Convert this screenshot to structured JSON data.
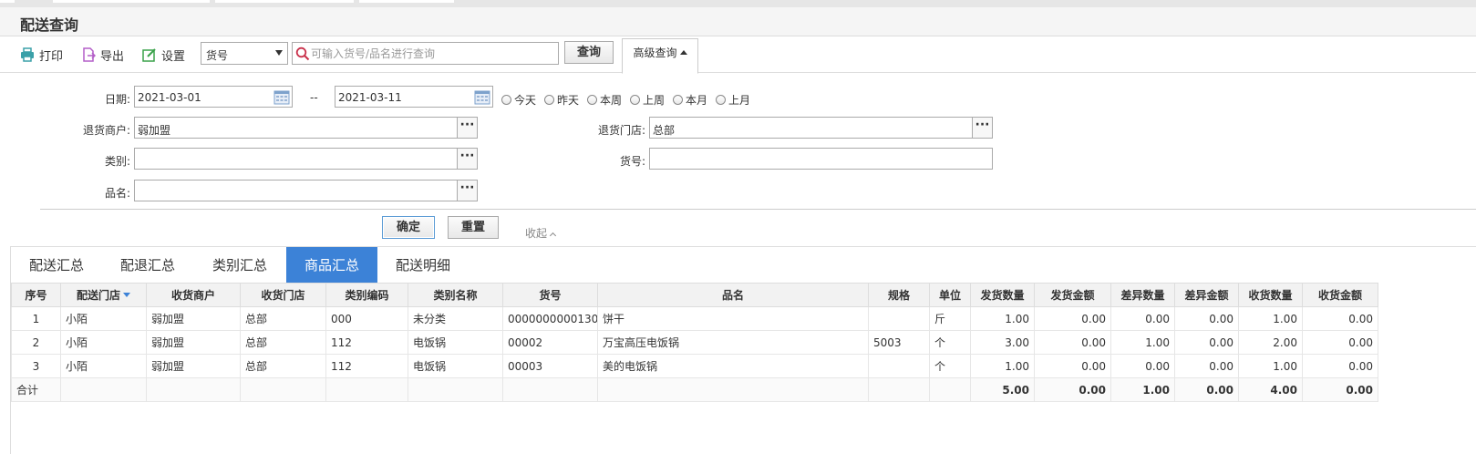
{
  "title": "配送查询",
  "toolbar": {
    "print_label": "打印",
    "export_label": "导出",
    "settings_label": "设置",
    "field_select": "货号",
    "search_placeholder": "可输入货号/品名进行查询",
    "query_label": "查询",
    "advanced_label": "高级查询"
  },
  "filters": {
    "date_label": "日期:",
    "date_from": "2021-03-01",
    "date_sep": "--",
    "date_to": "2021-03-11",
    "quick_dates": [
      "今天",
      "昨天",
      "本周",
      "上周",
      "本月",
      "上月"
    ],
    "merchant_label": "退货商户:",
    "merchant_value": "弱加盟",
    "store_label": "退货门店:",
    "store_value": "总部",
    "category_label": "类别:",
    "category_value": "",
    "sku_label": "货号:",
    "sku_value": "",
    "name_label": "品名:",
    "name_value": "",
    "confirm_label": "确定",
    "reset_label": "重置",
    "collapse_label": "收起"
  },
  "tabs": [
    "配送汇总",
    "配退汇总",
    "类别汇总",
    "商品汇总",
    "配送明细"
  ],
  "active_tab": "商品汇总",
  "table": {
    "columns": [
      "序号",
      "配送门店",
      "收货商户",
      "收货门店",
      "类别编码",
      "类别名称",
      "货号",
      "品名",
      "规格",
      "单位",
      "发货数量",
      "发货金额",
      "差异数量",
      "差异金额",
      "收货数量",
      "收货金额"
    ],
    "rows": [
      [
        "1",
        "小陌",
        "弱加盟",
        "总部",
        "000",
        "未分类",
        "0000000000130",
        "饼干",
        "",
        "斤",
        "1.00",
        "0.00",
        "0.00",
        "0.00",
        "1.00",
        "0.00"
      ],
      [
        "2",
        "小陌",
        "弱加盟",
        "总部",
        "112",
        "电饭锅",
        "00002",
        "万宝高压电饭锅",
        "5003",
        "个",
        "3.00",
        "0.00",
        "1.00",
        "0.00",
        "2.00",
        "0.00"
      ],
      [
        "3",
        "小陌",
        "弱加盟",
        "总部",
        "112",
        "电饭锅",
        "00003",
        "美的电饭锅",
        "",
        "个",
        "1.00",
        "0.00",
        "0.00",
        "0.00",
        "1.00",
        "0.00"
      ]
    ],
    "total": [
      "合计",
      "",
      "",
      "",
      "",
      "",
      "",
      "",
      "",
      "",
      "5.00",
      "0.00",
      "1.00",
      "0.00",
      "4.00",
      "0.00"
    ]
  },
  "colors": {
    "accent": "#3c82d7",
    "print_icon": "#3aa0a8",
    "export_icon": "#b45fc8",
    "settings_icon": "#3aa24a"
  }
}
